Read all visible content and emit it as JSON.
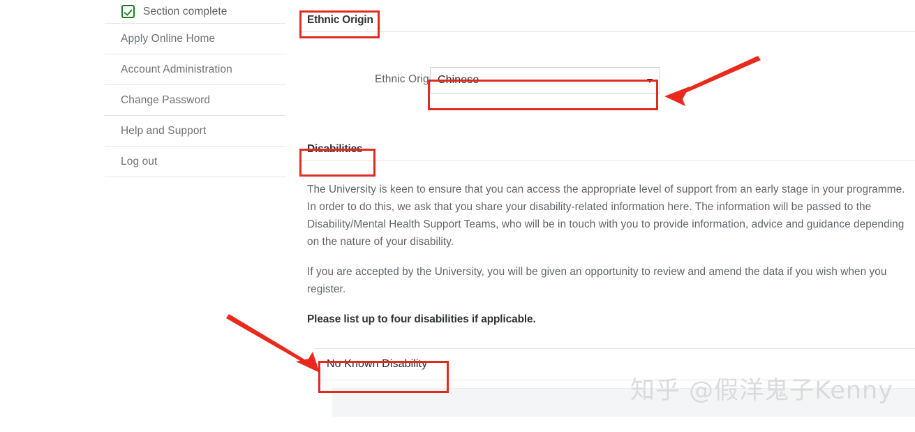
{
  "sidebar": {
    "status": {
      "icon": "checkbox-checked-icon",
      "label": "Section complete"
    },
    "items": [
      {
        "label": "Apply Online Home"
      },
      {
        "label": "Account Administration"
      },
      {
        "label": "Change Password"
      },
      {
        "label": "Help and Support"
      },
      {
        "label": "Log out"
      }
    ]
  },
  "main": {
    "ethnic_origin_section": {
      "heading": "Ethnic Origin",
      "field_label": "Ethnic Origin",
      "selected_value": "Chinese",
      "caret_icon": "chevron-down-icon"
    },
    "disabilities_section": {
      "heading": "Disabilities",
      "paragraph_1": "The University is keen to ensure that you can access the appropriate level of support from an early stage in your programme. In order to do this, we ask that you share your disability-related information here. The information will be passed to the Disability/Mental Health Support Teams, who will be in touch with you to provide information, advice and guidance depending on the nature of your disability.",
      "paragraph_2": "If you are accepted by the University, you will be given an opportunity to review and amend the data if you wish when you register.",
      "instruction": "Please list up to four disabilities if applicable.",
      "rows": [
        {
          "label": "No Known Disability"
        }
      ]
    }
  },
  "annotations": {
    "highlight_color": "#e02b20",
    "arrow_color": "#e8291c",
    "highlights": [
      {
        "name": "ethnic-origin-heading-highlight"
      },
      {
        "name": "ethnic-origin-select-highlight"
      },
      {
        "name": "disabilities-heading-highlight"
      },
      {
        "name": "no-known-disability-highlight"
      }
    ],
    "arrows": [
      {
        "name": "arrow-to-select"
      },
      {
        "name": "arrow-to-disability-row"
      }
    ]
  },
  "watermark": {
    "text": "知乎 @假洋鬼子Kenny"
  }
}
